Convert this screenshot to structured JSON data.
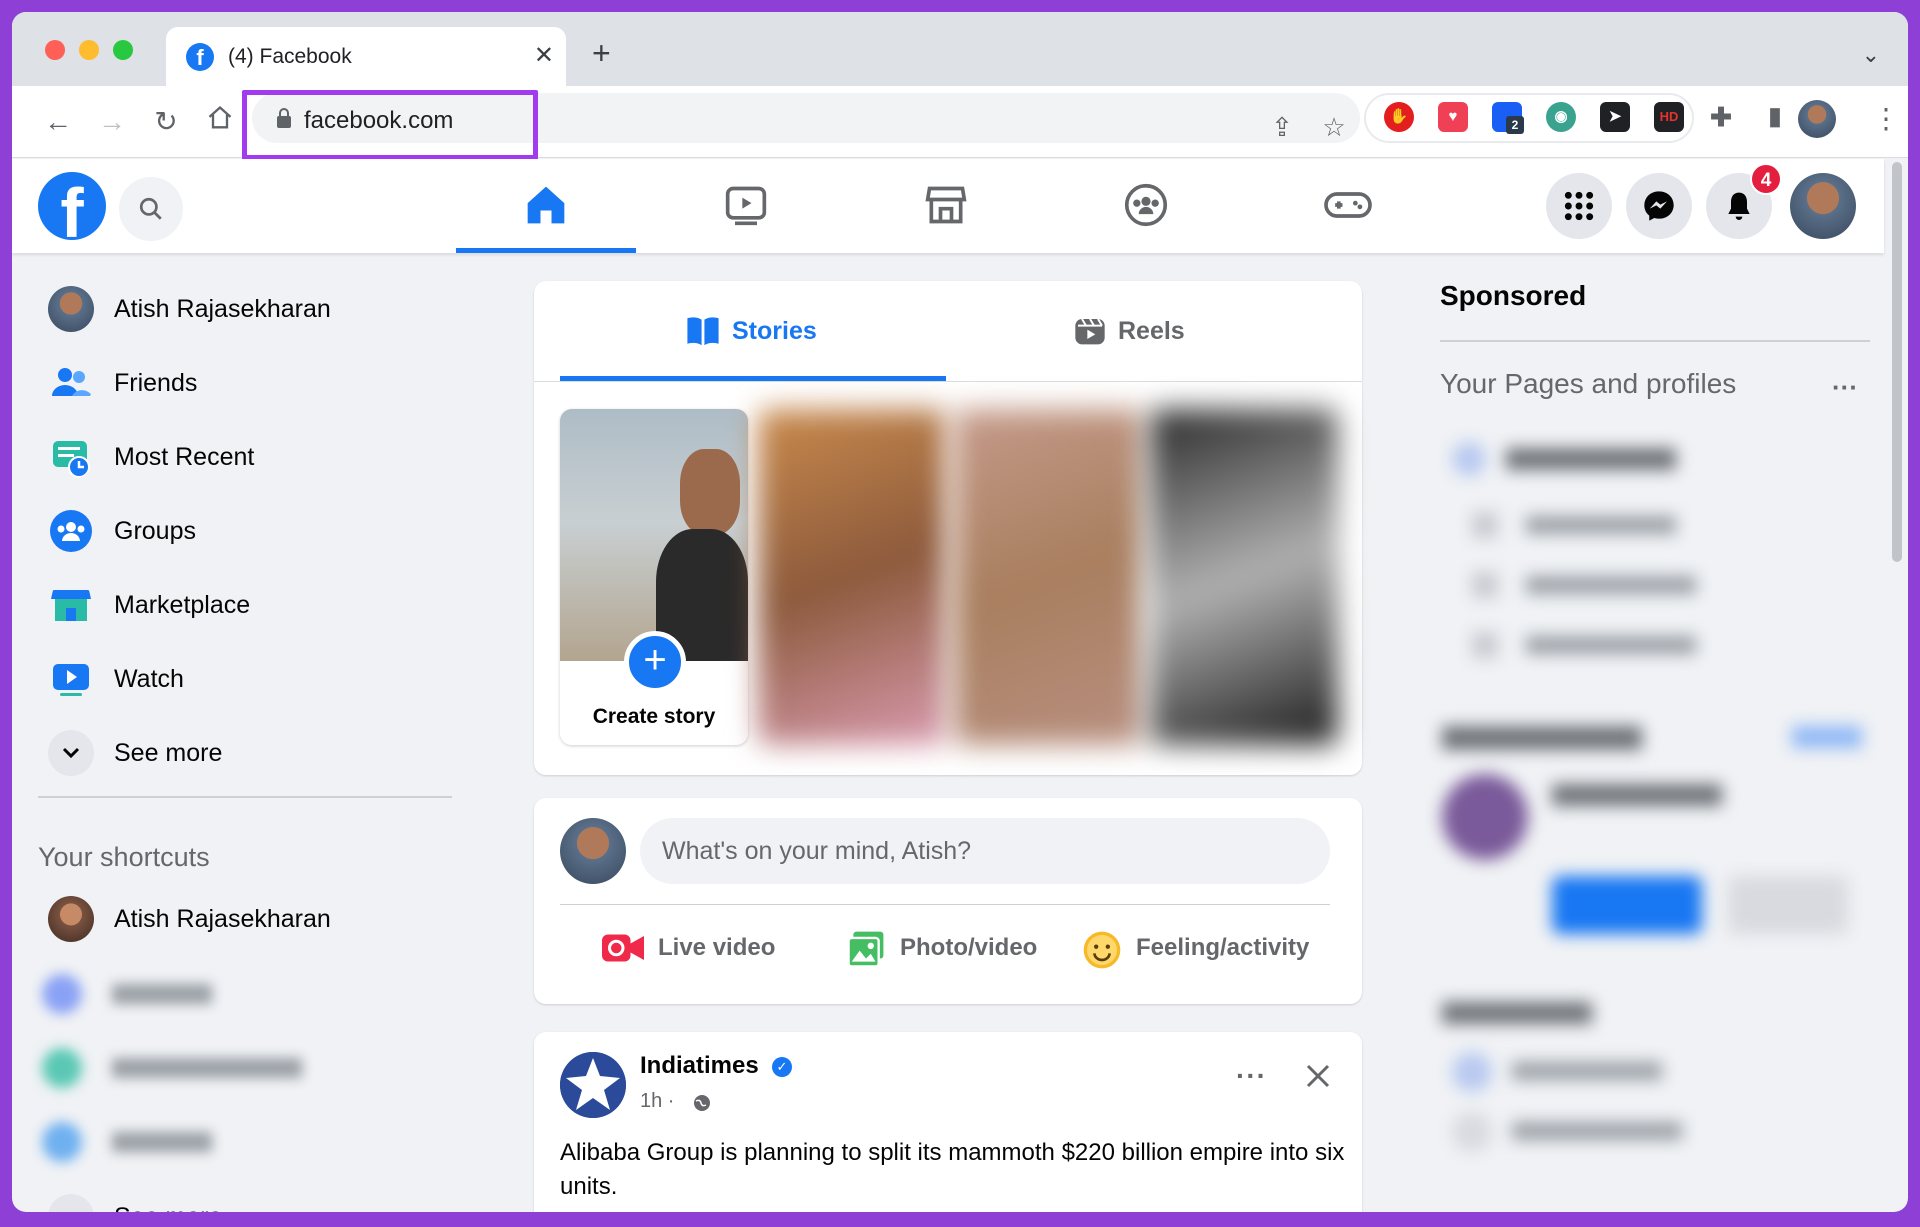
{
  "browser": {
    "tab_title": "(4) Facebook",
    "tab_favicon": "f",
    "url": "facebook.com",
    "extension_badge": "2",
    "hd_label": "HD"
  },
  "header": {
    "notifications_count": "4"
  },
  "sidebar": {
    "items": [
      {
        "label": "Atish Rajasekharan",
        "icon": "avatar"
      },
      {
        "label": "Friends",
        "icon": "friends-icon"
      },
      {
        "label": "Most Recent",
        "icon": "most-recent-icon"
      },
      {
        "label": "Groups",
        "icon": "groups-icon"
      },
      {
        "label": "Marketplace",
        "icon": "marketplace-icon"
      },
      {
        "label": "Watch",
        "icon": "watch-icon"
      },
      {
        "label": "See more",
        "icon": "chevron-down-icon"
      }
    ],
    "shortcuts_title": "Your shortcuts",
    "shortcuts": [
      {
        "label": "Atish Rajasekharan"
      }
    ],
    "shortcuts_see_more": "See more"
  },
  "stories": {
    "tabs": [
      "Stories",
      "Reels"
    ],
    "create_story_label": "Create story"
  },
  "composer": {
    "placeholder": "What's on your mind, Atish?",
    "actions": [
      "Live video",
      "Photo/video",
      "Feeling/activity"
    ]
  },
  "post": {
    "author": "Indiatimes",
    "time": "1h ·",
    "text": "Alibaba Group is planning to split its mammoth $220 billion empire into six units."
  },
  "right_column": {
    "sponsored_title": "Sponsored",
    "pages_title": "Your Pages and profiles",
    "pages_more": "···"
  },
  "colors": {
    "brand": "#1877f2",
    "highlight": "#a23bf0",
    "badge": "#e41e3f"
  }
}
